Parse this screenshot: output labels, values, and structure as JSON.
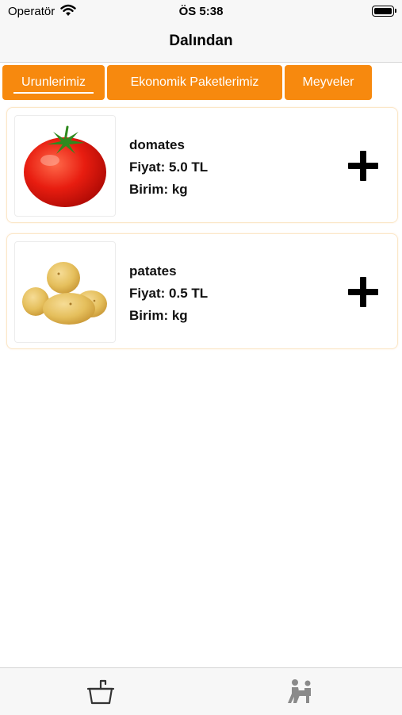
{
  "status_bar": {
    "carrier": "Operatör",
    "time": "ÖS 5:38"
  },
  "nav": {
    "title": "Dalından"
  },
  "tabs": [
    {
      "label": "Urunlerimiz",
      "selected": true
    },
    {
      "label": "Ekonomik Paketlerimiz",
      "selected": false
    },
    {
      "label": "Meyveler",
      "selected": false
    }
  ],
  "products": [
    {
      "name": "domates",
      "price": "Fiyat: 5.0 TL",
      "unit": "Birim: kg",
      "image": "tomato-image"
    },
    {
      "name": "patates",
      "price": "Fiyat: 0.5 TL",
      "unit": "Birim: kg",
      "image": "potato-image"
    }
  ],
  "tab_bar": {
    "items": [
      {
        "icon": "basket-icon"
      },
      {
        "icon": "delivery-person-icon"
      }
    ]
  },
  "colors": {
    "accent": "#f7890e",
    "bar_background": "#f7f7f7",
    "card_border": "#fbe7c8"
  }
}
